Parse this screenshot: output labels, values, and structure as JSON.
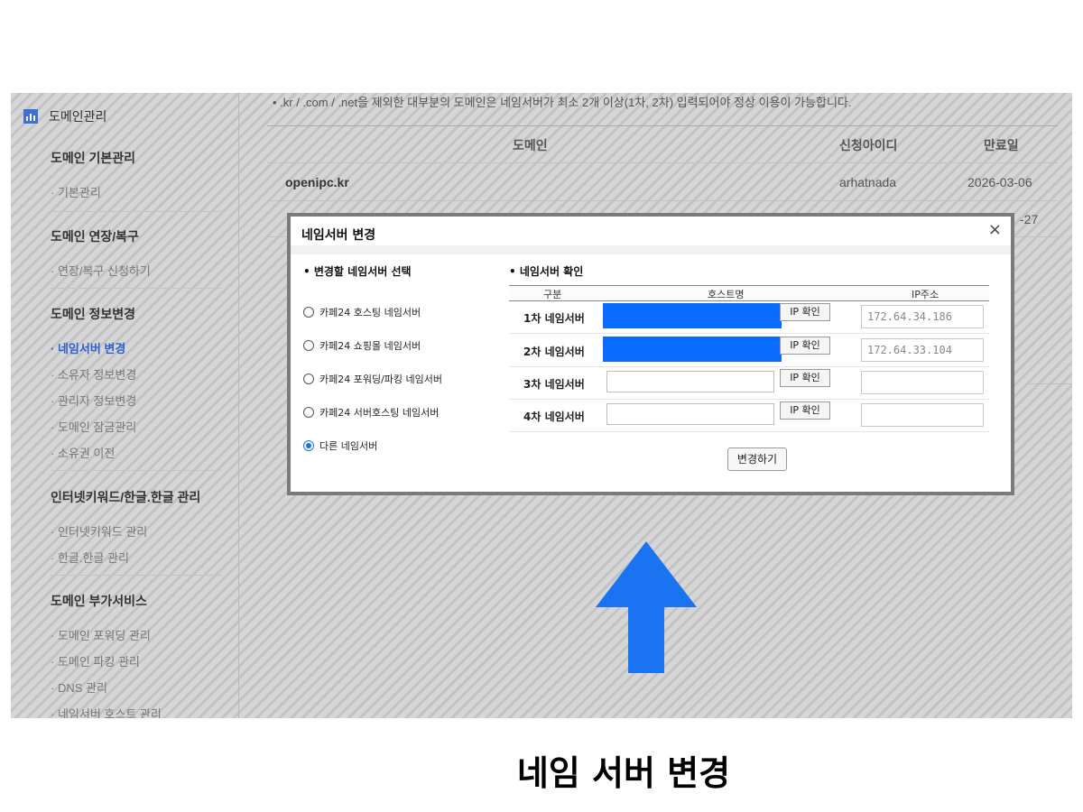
{
  "sidebar": {
    "top_label": "도메인관리",
    "sections": [
      {
        "title": "도메인 기본관리",
        "items": [
          {
            "label": "· 기본관리"
          }
        ]
      },
      {
        "title": "도메인 연장/복구",
        "items": [
          {
            "label": "· 연장/복구 신청하기"
          }
        ]
      },
      {
        "title": "도메인 정보변경",
        "items": [
          {
            "label": "· 네임서버 변경",
            "active": true
          },
          {
            "label": "· 소유자 정보변경"
          },
          {
            "label": "· 관리자 정보변경"
          },
          {
            "label": "· 도메인 잠금관리"
          },
          {
            "label": "· 소유권 이전"
          }
        ]
      },
      {
        "title": "인터넷키워드/한글.한글 관리",
        "items": [
          {
            "label": "· 인터넷키워드 관리"
          },
          {
            "label": "· 한글.한글 관리"
          }
        ]
      },
      {
        "title": "도메인 부가서비스",
        "items": [
          {
            "label": "· 도메인 포워딩 관리"
          },
          {
            "label": "· 도메인 파킹 관리"
          },
          {
            "label": "· DNS 관리"
          },
          {
            "label": "· 네임서버 호스트 관리"
          }
        ]
      }
    ]
  },
  "main": {
    "notice": "• .kr / .com / .net을 제외한 대부분의 도메인은 네임서버가 최소 2개 이상(1차, 2차) 입력되어야 정상 이용이 가능합니다.",
    "table": {
      "headers": [
        "도메인",
        "신청아이디",
        "만료일"
      ],
      "row": {
        "domain": "openipc.kr",
        "user": "arhatnada",
        "expiry": "2026-03-06"
      },
      "partial_date": "-27"
    }
  },
  "modal": {
    "title": "네임서버 변경",
    "close_label": "×",
    "left_heading": "• 변경할 네임서버 선택",
    "right_heading": "• 네임서버 확인",
    "options": [
      {
        "label": "카페24 호스팅 네임서버",
        "checked": false
      },
      {
        "label": "카페24 쇼핑몰 네임서버",
        "checked": false
      },
      {
        "label": "카페24 포워딩/파킹 네임서버",
        "checked": false
      },
      {
        "label": "카페24 서버호스팅 네임서버",
        "checked": false
      },
      {
        "label": "다른 네임서버",
        "checked": true
      }
    ],
    "columns": {
      "type": "구분",
      "host": "호스트명",
      "ip": "IP주소"
    },
    "rows": [
      {
        "label": "1차 네임서버",
        "check": "IP 확인",
        "ip": "172.64.34.186"
      },
      {
        "label": "2차 네임서버",
        "check": "IP 확인",
        "ip": "172.64.33.104"
      },
      {
        "label": "3차 네임서버",
        "check": "IP 확인",
        "ip": ""
      },
      {
        "label": "4차 네임서버",
        "check": "IP 확인",
        "ip": ""
      }
    ],
    "submit_label": "변경하기"
  },
  "caption": "네임 서버 변경",
  "colors": {
    "accent": "#0a6cff",
    "arrow": "#1a73f0",
    "active_link": "#2f5fd0"
  }
}
